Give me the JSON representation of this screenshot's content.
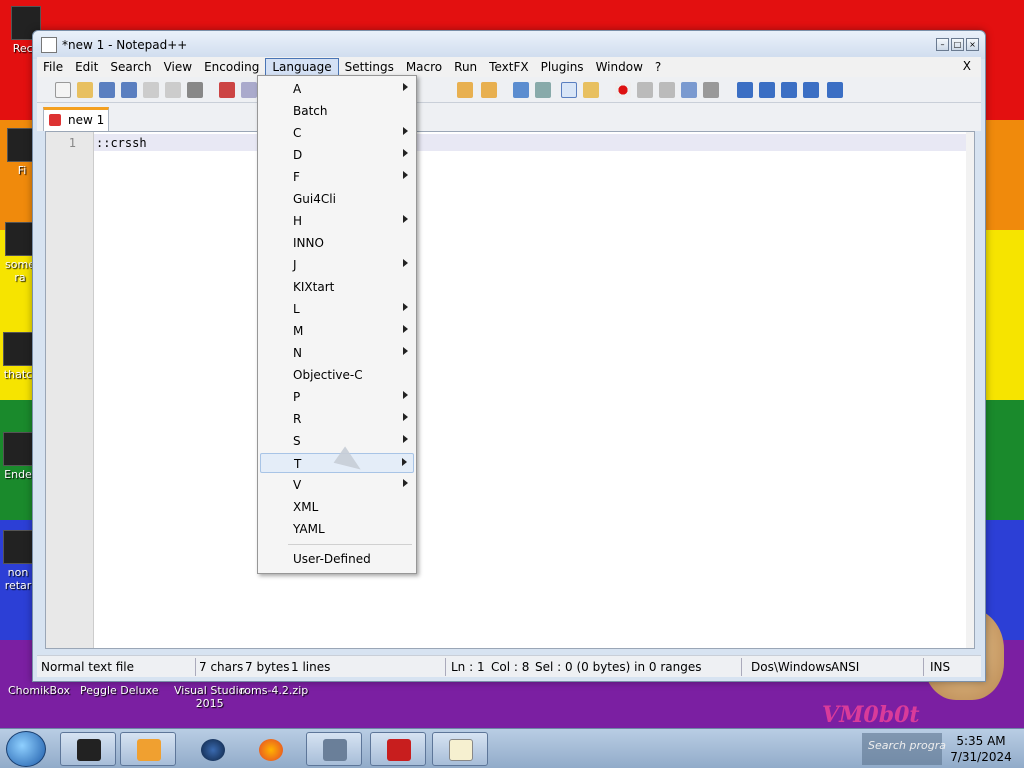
{
  "window": {
    "title": "*new 1 - Notepad++",
    "menu": [
      "File",
      "Edit",
      "Search",
      "View",
      "Encoding",
      "Language",
      "Settings",
      "Macro",
      "Run",
      "TextFX",
      "Plugins",
      "Window",
      "?"
    ],
    "active_menu": "Language",
    "close_doc": "X"
  },
  "tab": {
    "label": "new 1"
  },
  "editor": {
    "line_number": "1",
    "content": "::crssh"
  },
  "language_menu": {
    "items": [
      {
        "label": "A",
        "submenu": true
      },
      {
        "label": "Batch",
        "submenu": false
      },
      {
        "label": "C",
        "submenu": true
      },
      {
        "label": "D",
        "submenu": true
      },
      {
        "label": "F",
        "submenu": true
      },
      {
        "label": "Gui4Cli",
        "submenu": false
      },
      {
        "label": "H",
        "submenu": true
      },
      {
        "label": "INNO",
        "submenu": false
      },
      {
        "label": "J",
        "submenu": true
      },
      {
        "label": "KIXtart",
        "submenu": false
      },
      {
        "label": "L",
        "submenu": true
      },
      {
        "label": "M",
        "submenu": true
      },
      {
        "label": "N",
        "submenu": true
      },
      {
        "label": "Objective-C",
        "submenu": false
      },
      {
        "label": "P",
        "submenu": true
      },
      {
        "label": "R",
        "submenu": true
      },
      {
        "label": "S",
        "submenu": true
      },
      {
        "label": "T",
        "submenu": true,
        "highlighted": true
      },
      {
        "label": "V",
        "submenu": true
      },
      {
        "label": "XML",
        "submenu": false
      },
      {
        "label": "YAML",
        "submenu": false
      }
    ],
    "user_defined": "User-Defined"
  },
  "status": {
    "file_type": "Normal text file",
    "chars": "7 chars",
    "bytes": "7 bytes",
    "lines": "1 lines",
    "ln": "Ln : 1",
    "col": "Col : 8",
    "sel": "Sel : 0 (0 bytes) in 0 ranges",
    "eol": "Dos\\Windows",
    "encoding": "ANSI",
    "mode": "INS"
  },
  "desktop": {
    "icons_left": [
      "Recy",
      "Fi",
      "some\nra",
      "thatc",
      "Ende",
      "non\nretar"
    ],
    "bottom_labels": [
      "ChomikBox",
      "Peggle Deluxe",
      "Visual Studio\n2015",
      "roms-4.2.zip"
    ]
  },
  "taskbar": {
    "search_placeholder": "Search progra",
    "time": "5:35 AM",
    "date": "7/31/2024"
  },
  "watermark": "VM0b0t",
  "colors": {
    "menu_highlight": "#d4e1f5",
    "tab_accent": "#f4a020",
    "taskbar": "#a7bdd8"
  }
}
